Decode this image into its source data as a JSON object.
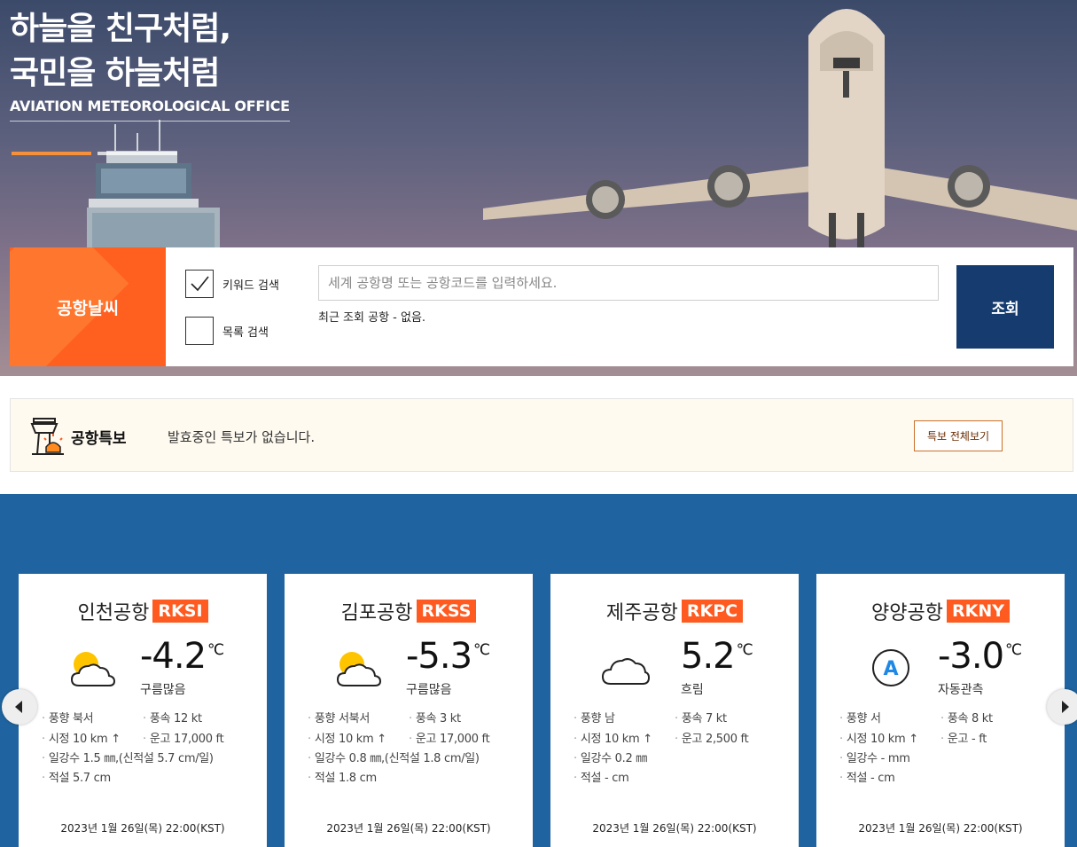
{
  "hero": {
    "slogan_line1": "하늘을 친구처럼,",
    "slogan_line2": "국민을 하늘처럼",
    "org_name": "AVIATION METEOROLOGICAL OFFICE"
  },
  "search": {
    "label": "공항날씨",
    "keyword_option": "키워드 검색",
    "list_option": "목록 검색",
    "placeholder": "세계 공항명 또는 공항코드를 입력하세요.",
    "recent_text": "최근 조회 공항 - 없음.",
    "button": "조회"
  },
  "alert": {
    "title": "공항특보",
    "message": "발효중인 특보가 없습니다.",
    "button": "특보 전체보기"
  },
  "colors": {
    "accent_orange": "#ff5a1f",
    "navy": "#163c6f",
    "section_blue": "#1f64a0"
  },
  "airports": [
    {
      "name": "인천공항",
      "code": "RKSI",
      "icon": "partly-cloudy-icon",
      "temp": "-4.2",
      "unit": "℃",
      "condition": "구름많음",
      "wind_dir": "풍향 북서",
      "wind_speed": "풍속 12 kt",
      "visibility": "시정 10 km ↑",
      "ceiling": "운고 17,000 ft",
      "precip": "일강수 1.5 ㎜,(신적설 5.7 cm/일)",
      "snow": "적설 5.7 cm",
      "time": "2023년 1월 26일(목) 22:00(KST)"
    },
    {
      "name": "김포공항",
      "code": "RKSS",
      "icon": "partly-cloudy-icon",
      "temp": "-5.3",
      "unit": "℃",
      "condition": "구름많음",
      "wind_dir": "풍향 서북서",
      "wind_speed": "풍속 3 kt",
      "visibility": "시정 10 km ↑",
      "ceiling": "운고 17,000 ft",
      "precip": "일강수 0.8 ㎜,(신적설 1.8 cm/일)",
      "snow": "적설 1.8 cm",
      "time": "2023년 1월 26일(목) 22:00(KST)"
    },
    {
      "name": "제주공항",
      "code": "RKPC",
      "icon": "cloudy-icon",
      "temp": "5.2",
      "unit": "℃",
      "condition": "흐림",
      "wind_dir": "풍향 남",
      "wind_speed": "풍속 7 kt",
      "visibility": "시정 10 km ↑",
      "ceiling": "운고 2,500 ft",
      "precip": "일강수 0.2 ㎜",
      "snow": "적설 - cm",
      "time": "2023년 1월 26일(목) 22:00(KST)"
    },
    {
      "name": "양양공항",
      "code": "RKNY",
      "icon": "auto-observation-icon",
      "icon_letter": "A",
      "temp": "-3.0",
      "unit": "℃",
      "condition": "자동관측",
      "wind_dir": "풍향 서",
      "wind_speed": "풍속 8 kt",
      "visibility": "시정 10 km ↑",
      "ceiling": "운고 - ft",
      "precip": "일강수 - mm",
      "snow": "적설 - cm",
      "time": "2023년 1월 26일(목) 22:00(KST)"
    }
  ]
}
